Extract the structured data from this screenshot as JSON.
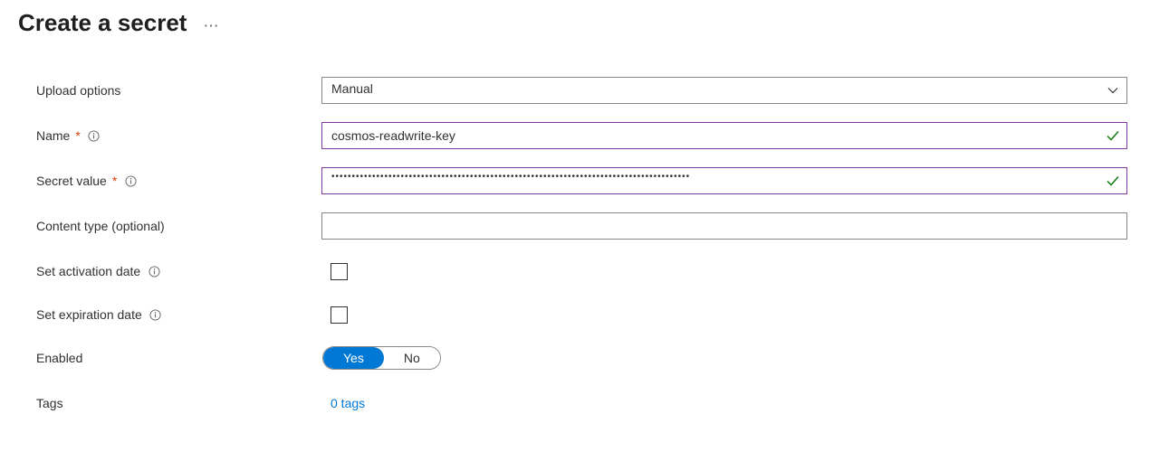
{
  "header": {
    "title": "Create a secret"
  },
  "form": {
    "upload_options": {
      "label": "Upload options",
      "value": "Manual"
    },
    "name": {
      "label": "Name",
      "value": "cosmos-readwrite-key"
    },
    "secret_value": {
      "label": "Secret value",
      "display": "••••••••••••••••••••••••••••••••••••••••••••••••••••••••••••••••••••••••••••••••••••••••"
    },
    "content_type": {
      "label": "Content type (optional)",
      "value": ""
    },
    "activation": {
      "label": "Set activation date"
    },
    "expiration": {
      "label": "Set expiration date"
    },
    "enabled": {
      "label": "Enabled",
      "yes": "Yes",
      "no": "No"
    },
    "tags": {
      "label": "Tags",
      "value": "0 tags"
    }
  }
}
